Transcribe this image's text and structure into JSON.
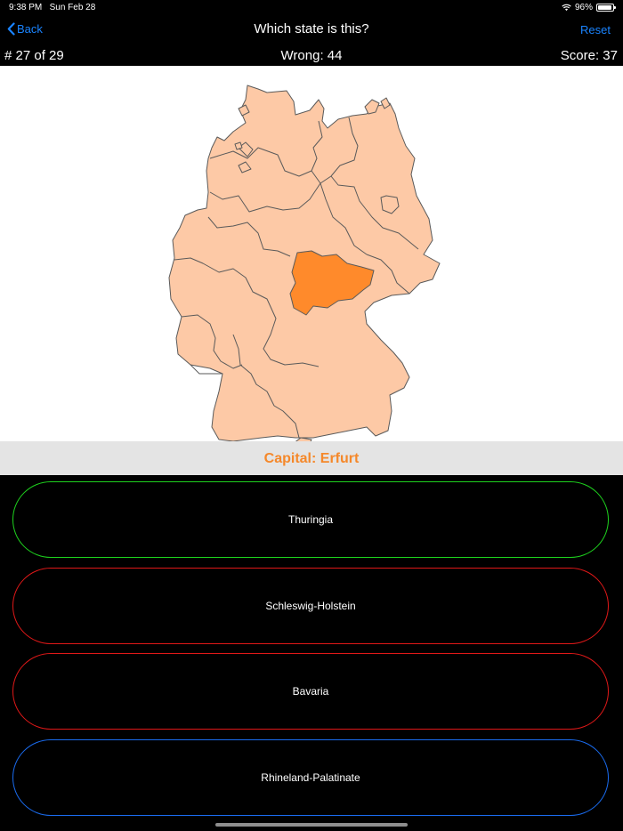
{
  "status": {
    "time": "9:38 PM",
    "date": "Sun Feb 28",
    "battery": "96%"
  },
  "nav": {
    "back_label": "Back",
    "title": "Which state is this?",
    "reset_label": "Reset"
  },
  "info": {
    "question": "# 27 of 29",
    "wrong": "Wrong: 44",
    "score": "Score: 37"
  },
  "capital": "Capital: Erfurt",
  "colors": {
    "accent": "#1a84ff",
    "state_fill": "#fdc9a6",
    "highlight": "#ff8a2b",
    "correct": "#1ed31e",
    "wrong": "#e01818",
    "neutral": "#1a6cf0"
  },
  "options": [
    {
      "label": "Thuringia",
      "state": "correct"
    },
    {
      "label": "Schleswig-Holstein",
      "state": "wrong"
    },
    {
      "label": "Bavaria",
      "state": "wrong"
    },
    {
      "label": "Rhineland-Palatinate",
      "state": "neutral"
    }
  ]
}
